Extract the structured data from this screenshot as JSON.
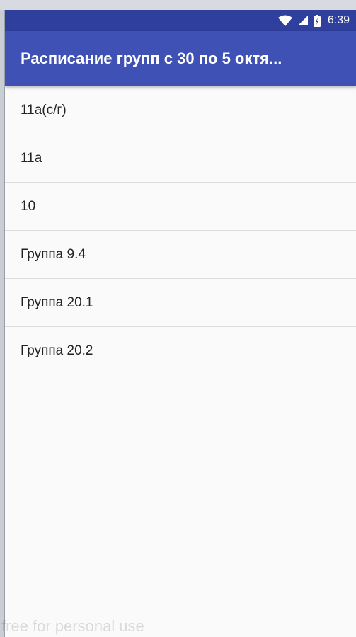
{
  "status_bar": {
    "time": "6:39",
    "icons": [
      "wifi-icon",
      "signal-icon",
      "battery-icon"
    ]
  },
  "app_bar": {
    "title": "Расписание групп с 30 по 5 октя..."
  },
  "groups": [
    {
      "label": "11а(с/г)"
    },
    {
      "label": "11а"
    },
    {
      "label": "10"
    },
    {
      "label": "Группа 9.4"
    },
    {
      "label": "Группа 20.1"
    },
    {
      "label": "Группа 20.2"
    }
  ],
  "watermark": "free for personal use",
  "colors": {
    "status_bar": "#2f3f9e",
    "app_bar": "#3f51b5",
    "background": "#fafafa"
  }
}
